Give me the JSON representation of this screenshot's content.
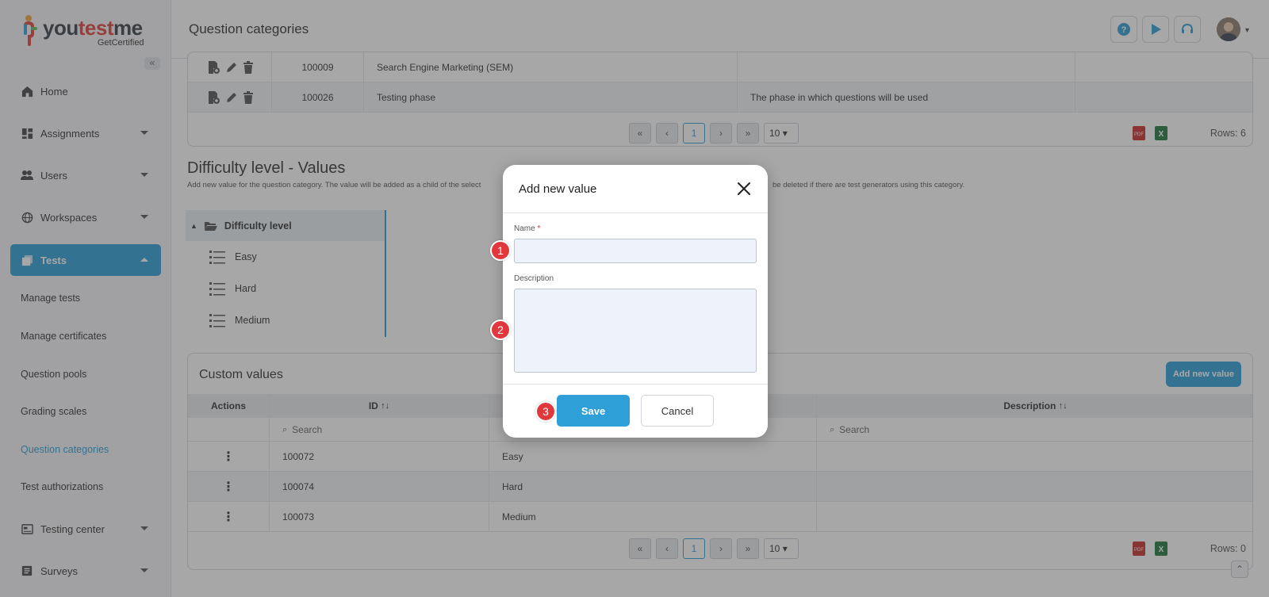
{
  "app": {
    "logo_text_prefix": "you",
    "logo_text_mid": "test",
    "logo_text_suffix": "me",
    "logo_sub": "GetCertified"
  },
  "header": {
    "title": "Question categories"
  },
  "sidebar": {
    "items": [
      {
        "label": "Home",
        "icon": "home-icon"
      },
      {
        "label": "Assignments",
        "icon": "assignments-icon"
      },
      {
        "label": "Users",
        "icon": "users-icon"
      },
      {
        "label": "Workspaces",
        "icon": "globe-icon"
      },
      {
        "label": "Tests",
        "icon": "tests-icon"
      },
      {
        "label": "Testing center",
        "icon": "testing-center-icon"
      },
      {
        "label": "Surveys",
        "icon": "surveys-icon"
      }
    ],
    "sub_items": [
      "Manage tests",
      "Manage certificates",
      "Question pools",
      "Grading scales",
      "Question categories",
      "Test authorizations"
    ]
  },
  "top_table": {
    "rows": [
      {
        "id": "100009",
        "name": "Search Engine Marketing (SEM)",
        "description": ""
      },
      {
        "id": "100026",
        "name": "Testing phase",
        "description": "The phase in which questions will be used"
      }
    ],
    "page": "1",
    "page_size": "10",
    "rows_label": "Rows: 6"
  },
  "values_section": {
    "title": "Difficulty level - Values",
    "description_left": "Add new value for the question category. The value will be added as a child of the select",
    "description_right": "be deleted if there are test generators using this category.",
    "tree_root": "Difficulty level",
    "tree_leaves": [
      "Easy",
      "Hard",
      "Medium"
    ]
  },
  "custom_values": {
    "title": "Custom values",
    "add_button": "Add new value",
    "columns": {
      "actions": "Actions",
      "id": "ID",
      "name_partial": "",
      "description": "Description"
    },
    "search_placeholder": "Search",
    "rows": [
      {
        "id": "100072",
        "name": "Easy",
        "description": ""
      },
      {
        "id": "100074",
        "name": "Hard",
        "description": ""
      },
      {
        "id": "100073",
        "name": "Medium",
        "description": ""
      }
    ],
    "page": "1",
    "page_size": "10",
    "rows_label": "Rows: 0"
  },
  "modal": {
    "title": "Add new value",
    "name_label": "Name",
    "required_mark": "*",
    "description_label": "Description",
    "name_value": "",
    "description_value": "",
    "save_label": "Save",
    "cancel_label": "Cancel",
    "steps": [
      "1",
      "2",
      "3"
    ]
  },
  "colors": {
    "accent": "#2f9fd8",
    "step_badge": "#e0383d"
  }
}
